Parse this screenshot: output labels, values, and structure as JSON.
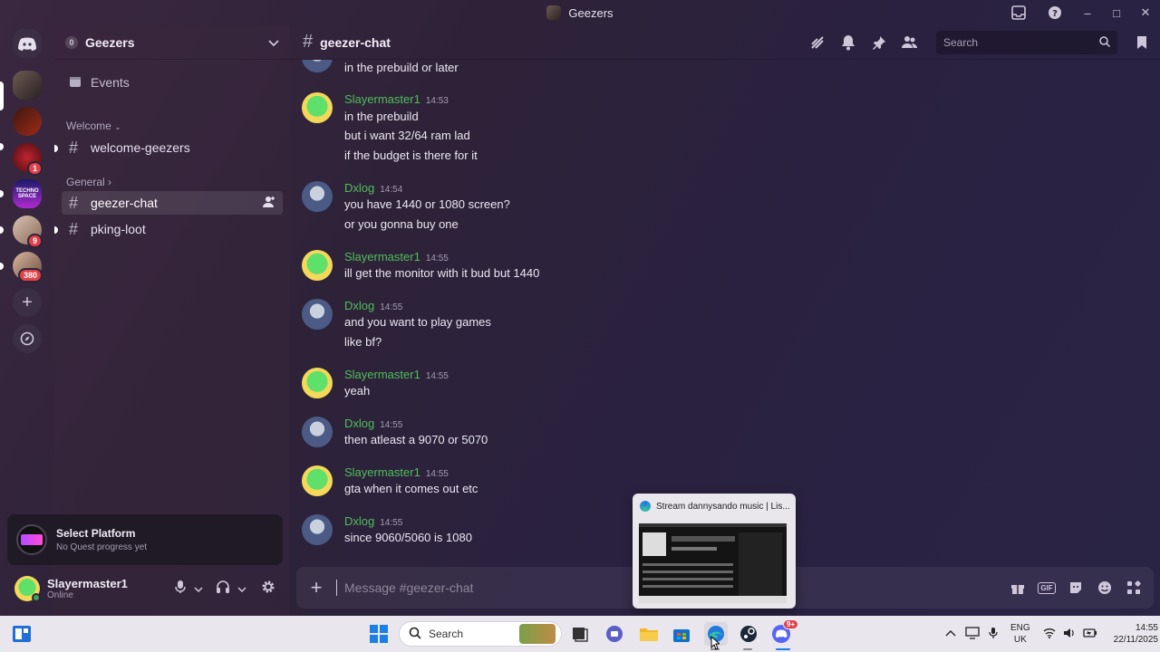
{
  "window": {
    "title": "Geezers"
  },
  "servers": {
    "badges": [
      "1",
      "9",
      "380"
    ],
    "banner_text": "TECHNO SPACE"
  },
  "sidebar": {
    "guild_name": "Geezers",
    "boost_count": "0",
    "events_label": "Events",
    "categories": [
      {
        "label": "Welcome"
      },
      {
        "label": "General"
      }
    ],
    "channels": [
      {
        "name": "welcome-geezers"
      },
      {
        "name": "geezer-chat"
      },
      {
        "name": "pking-loot"
      }
    ]
  },
  "quest": {
    "title": "Select Platform",
    "subtitle": "No Quest progress yet"
  },
  "user": {
    "name": "Slayermaster1",
    "status": "Online"
  },
  "chat": {
    "channel": "geezer-chat",
    "search_placeholder": "Search",
    "composer_placeholder": "Message #geezer-chat",
    "gif_label": "GIF",
    "messages": [
      {
        "lines": [
          "in the prebuild or later"
        ]
      },
      {
        "author": "Slayermaster1",
        "time": "14:53",
        "lines": [
          "in the prebuild",
          "but i want 32/64 ram lad",
          "if the budget is there for it"
        ]
      },
      {
        "author": "Dxlog",
        "time": "14:54",
        "lines": [
          "you have 1440 or 1080 screen?",
          "or you gonna buy one"
        ]
      },
      {
        "author": "Slayermaster1",
        "time": "14:55",
        "lines": [
          "ill get the monitor with it bud but 1440"
        ]
      },
      {
        "author": "Dxlog",
        "time": "14:55",
        "lines": [
          "and you want to play games",
          "like bf?"
        ]
      },
      {
        "author": "Slayermaster1",
        "time": "14:55",
        "lines": [
          "yeah"
        ]
      },
      {
        "author": "Dxlog",
        "time": "14:55",
        "lines": [
          "then atleast a 9070 or 5070"
        ]
      },
      {
        "author": "Slayermaster1",
        "time": "14:55",
        "lines": [
          "gta when it comes out etc"
        ]
      },
      {
        "author": "Dxlog",
        "time": "14:55",
        "lines": [
          "since 9060/5060 is 1080"
        ]
      }
    ]
  },
  "popup": {
    "title": "Stream dannysando music | Lis..."
  },
  "taskbar": {
    "search_label": "Search",
    "discord_badge": "9+",
    "lang_top": "ENG",
    "lang_bottom": "UK",
    "time": "14:55",
    "date": "22/11/2025"
  },
  "colors": {
    "username_green": "#4fbf5a",
    "badge_red": "#e0414a"
  }
}
